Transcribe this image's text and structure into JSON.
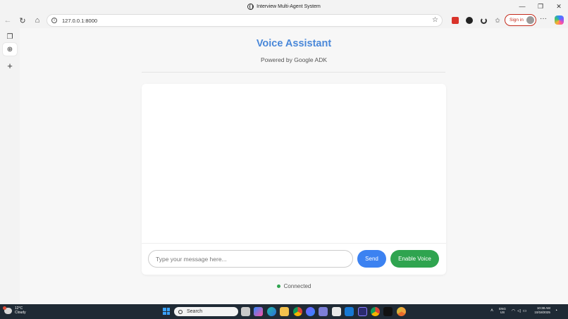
{
  "window": {
    "title": "Interview Multi-Agent System",
    "controls": {
      "minimize": "—",
      "maximize": "❐",
      "close": "✕"
    }
  },
  "toolbar": {
    "back_icon": "←",
    "refresh_icon": "↻",
    "home_icon": "⌂",
    "url": "127.0.0.1:8000",
    "favorite_icon": "☆",
    "sign_in_label": "Sign in",
    "more_icon": "···"
  },
  "siderail": {
    "tabs_icon": "❐",
    "globe_icon": "⊕",
    "add_icon": "+"
  },
  "app": {
    "title": "Voice Assistant",
    "subtitle": "Powered by Google ADK",
    "input_placeholder": "Type your message here...",
    "input_value": "",
    "send_label": "Send",
    "voice_label": "Enable Voice",
    "status_text": "Connected",
    "colors": {
      "title": "#4a88d9",
      "send": "#3c82f1",
      "voice": "#2fa44f",
      "status_dot": "#2fa44f"
    }
  },
  "taskbar": {
    "weather_temp": "12°C",
    "weather_desc": "Cloudy",
    "search_label": "Search",
    "apps": [
      "file-explorer",
      "copilot",
      "edge",
      "folder",
      "chrome",
      "chrome-dev",
      "teams",
      "store",
      "mail",
      "terminal",
      "vscode",
      "chrome-beta",
      "chrome-canary"
    ],
    "lang_top": "ENG",
    "lang_bottom": "US",
    "time": "10:38 AM",
    "date": "10/18/2025"
  }
}
